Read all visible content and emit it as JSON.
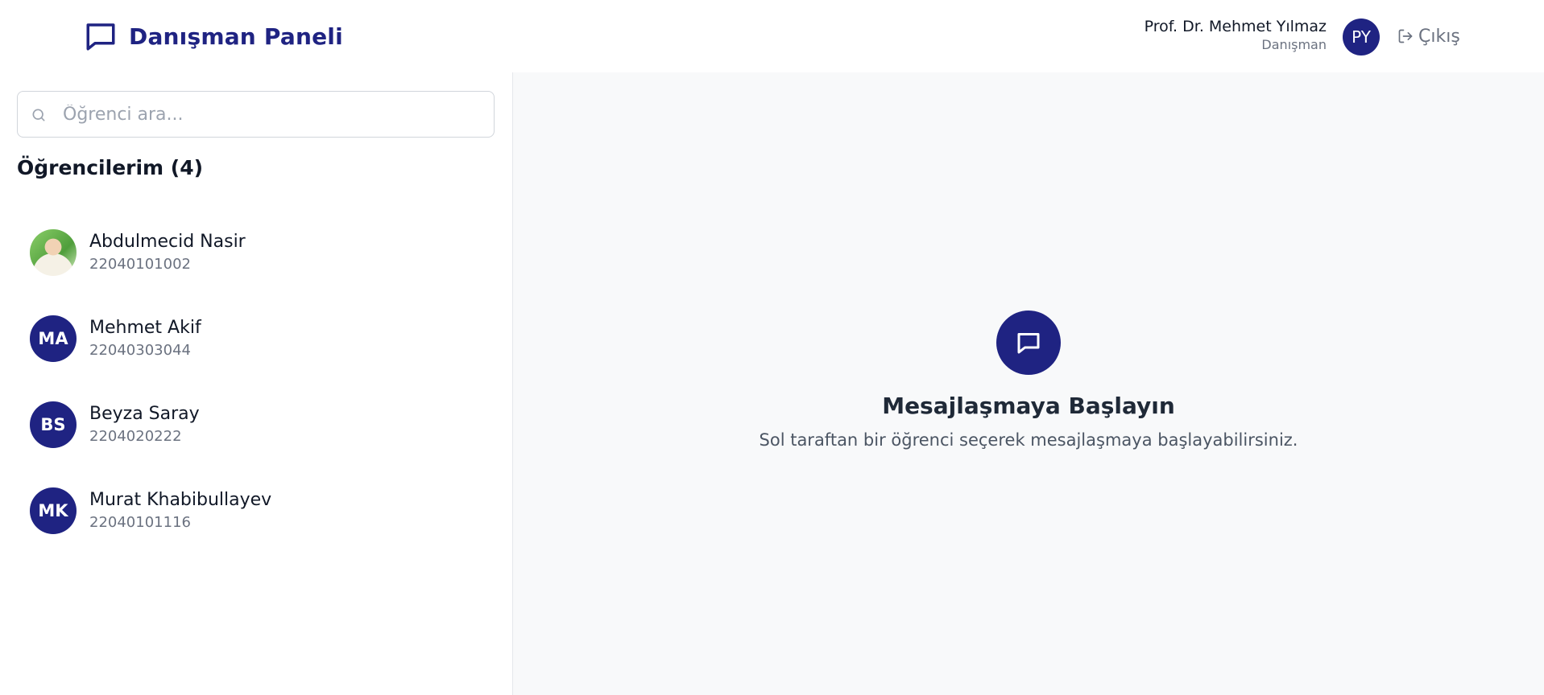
{
  "header": {
    "brand_title": "Danışman Paneli",
    "user_name": "Prof. Dr. Mehmet Yılmaz",
    "user_role": "Danışman",
    "user_initials": "PY",
    "logout_label": "Çıkış"
  },
  "sidebar": {
    "search_placeholder": "Öğrenci ara...",
    "list_title": "Öğrencilerim (4)",
    "students": [
      {
        "name": "Abdulmecid Nasir",
        "id": "22040101002",
        "initials": "",
        "has_photo": true
      },
      {
        "name": "Mehmet Akif",
        "id": "22040303044",
        "initials": "MA"
      },
      {
        "name": "Beyza Saray",
        "id": "2204020222",
        "initials": "BS"
      },
      {
        "name": "Murat Khabibullayev",
        "id": "22040101116",
        "initials": "MK"
      }
    ]
  },
  "main": {
    "empty_title": "Mesajlaşmaya Başlayın",
    "empty_text": "Sol taraftan bir öğrenci seçerek mesajlaşmaya başlayabilirsiniz."
  },
  "colors": {
    "brand": "#1f2382",
    "background_main": "#f8f9fa",
    "text_muted": "#6b7280"
  },
  "icons": {
    "brand": "chat-bubble-icon",
    "search": "search-icon",
    "logout": "logout-icon",
    "empty_state": "chat-bubble-icon"
  }
}
